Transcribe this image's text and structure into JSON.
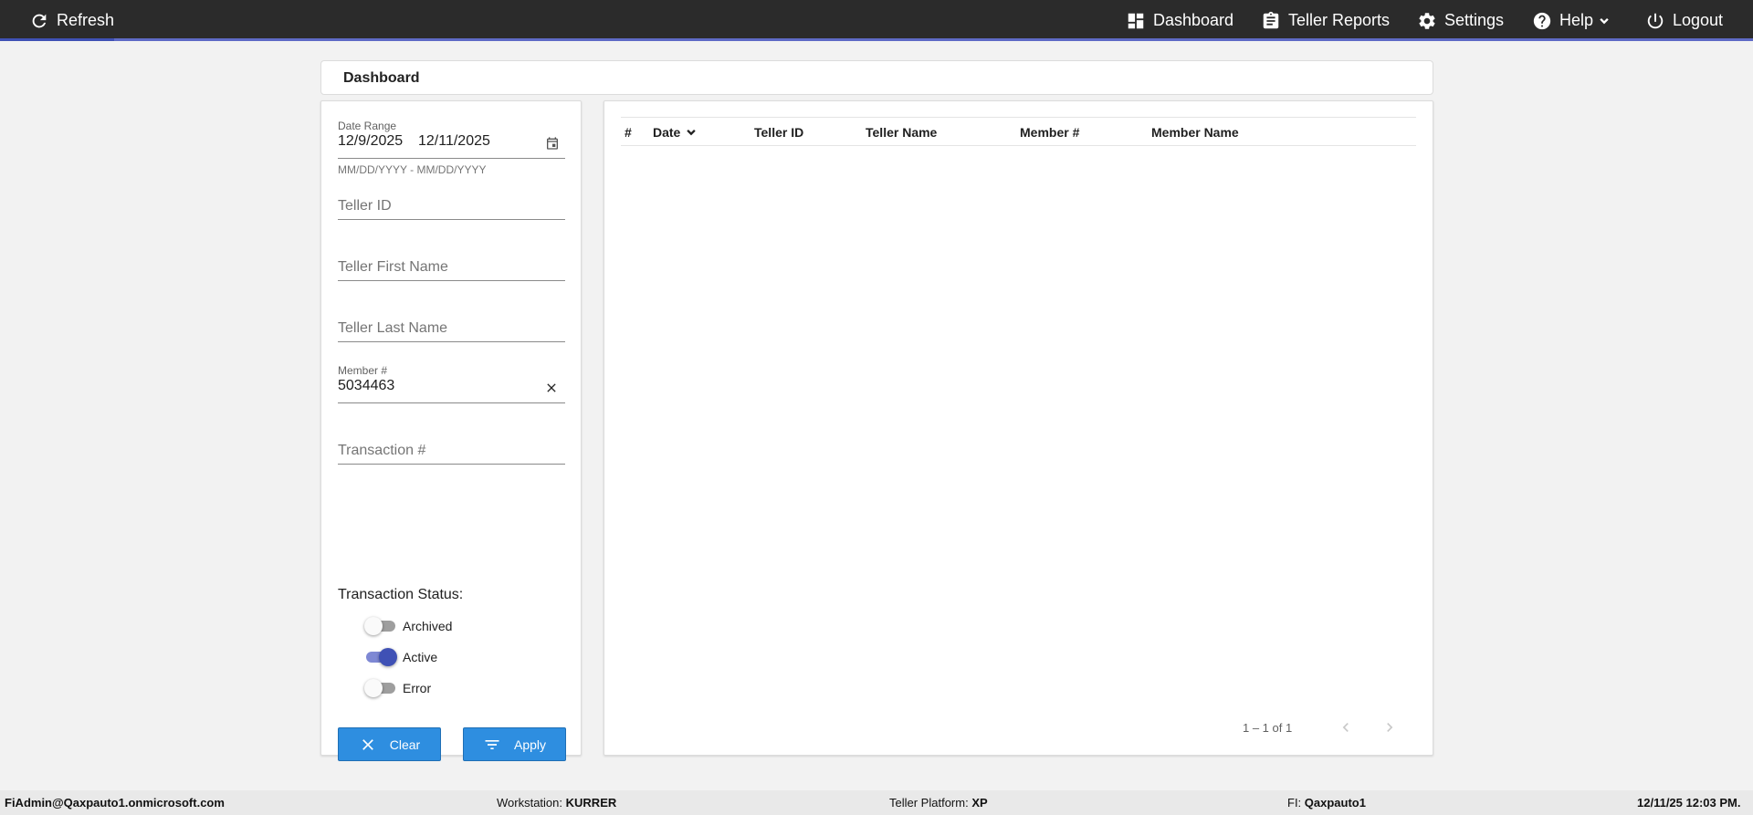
{
  "topbar": {
    "refresh_label": "Refresh",
    "nav": {
      "dashboard": "Dashboard",
      "teller_reports": "Teller Reports",
      "settings": "Settings",
      "help": "Help",
      "logout": "Logout"
    }
  },
  "header": {
    "title": "Dashboard"
  },
  "filters": {
    "date_range": {
      "label": "Date Range",
      "start": "12/9/2025",
      "end": "12/11/2025",
      "hint": "MM/DD/YYYY - MM/DD/YYYY"
    },
    "teller_id": {
      "placeholder": "Teller ID"
    },
    "teller_first_name": {
      "placeholder": "Teller First Name"
    },
    "teller_last_name": {
      "placeholder": "Teller Last Name"
    },
    "member_number": {
      "label": "Member #",
      "value": "5034463"
    },
    "transaction_number": {
      "placeholder": "Transaction #"
    },
    "status": {
      "title": "Transaction Status:",
      "toggles": [
        {
          "label": "Archived",
          "on": false
        },
        {
          "label": "Active",
          "on": true
        },
        {
          "label": "Error",
          "on": false
        }
      ]
    },
    "clear_label": "Clear",
    "apply_label": "Apply"
  },
  "table": {
    "columns": [
      "#",
      "Date",
      "Teller ID",
      "Teller Name",
      "Member #",
      "Member Name"
    ],
    "rows": [],
    "paging_text": "1 – 1 of 1"
  },
  "footer": {
    "user": "FiAdmin@Qaxpauto1.onmicrosoft.com",
    "workstation_label": "Workstation:",
    "workstation_value": "KURRER",
    "platform_label": "Teller Platform:",
    "platform_value": "XP",
    "fi_label": "FI:",
    "fi_value": "Qaxpauto1",
    "timestamp": "12/11/25 12:03 PM."
  },
  "colors": {
    "topbar": "#2b2b2b",
    "accent": "#3f51b5",
    "button": "#2e8ee0",
    "background": "#f2f2f2"
  }
}
